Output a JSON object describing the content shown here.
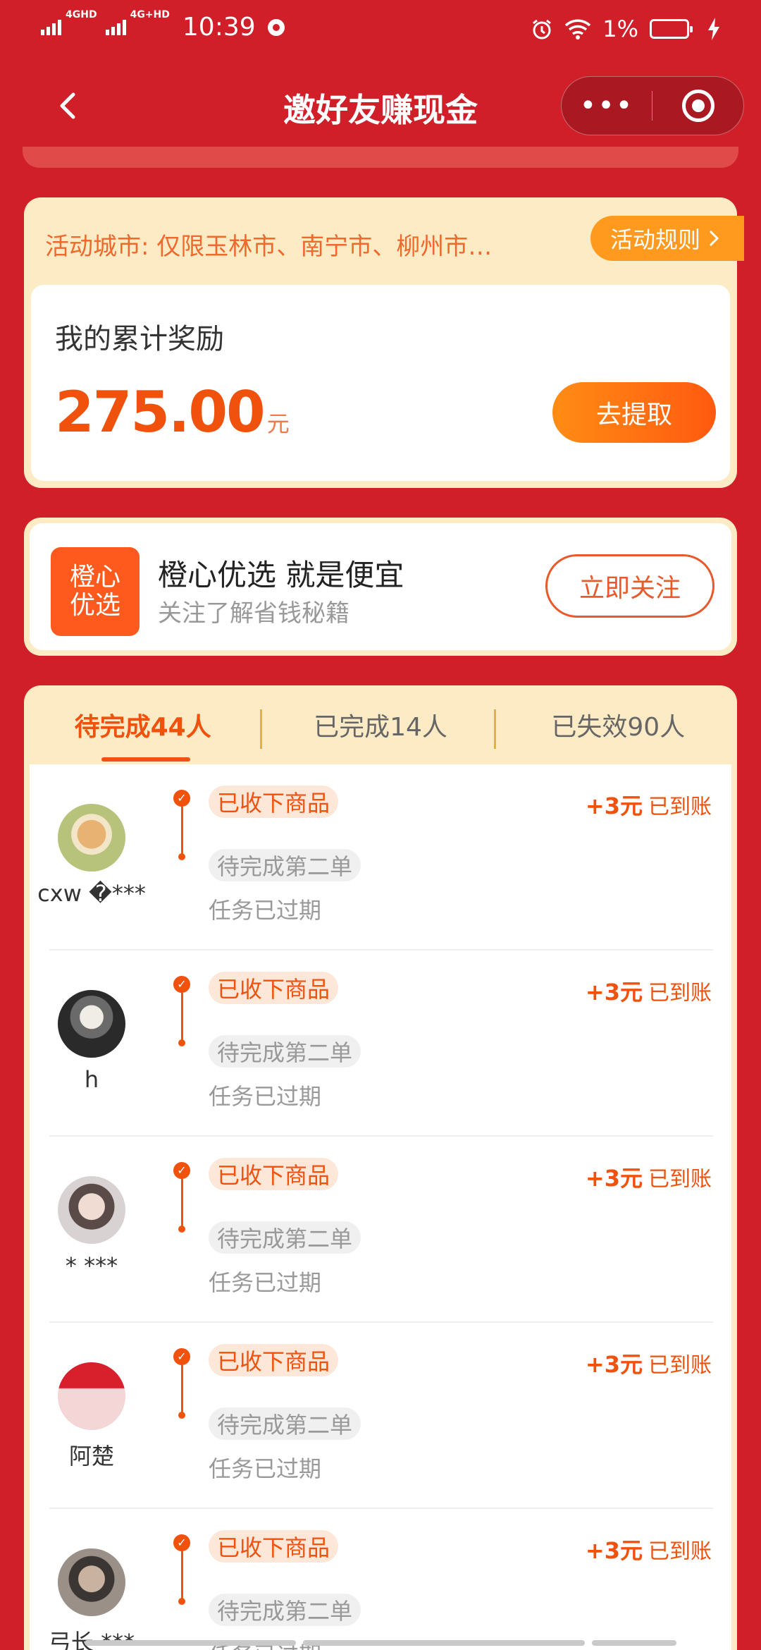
{
  "status_bar": {
    "net1": "4GHD",
    "net2": "4G+HD",
    "time": "10:39",
    "battery": "1%"
  },
  "header": {
    "title": "邀好友赚现金",
    "more": "•••"
  },
  "reward_card": {
    "notice": "活动城市: 仅限玉林市、南宁市、柳州市…",
    "rules": "活动规则",
    "label": "我的累计奖励",
    "amount": "275.00",
    "unit": "元",
    "withdraw": "去提取"
  },
  "follow_card": {
    "logo": "橙心优选",
    "logo_line1": "橙心",
    "logo_line2": "优选",
    "title": "橙心优选 就是便宜",
    "subtitle": "关注了解省钱秘籍",
    "button": "立即关注"
  },
  "tabs": [
    {
      "label": "待完成44人",
      "active": true
    },
    {
      "label": "已完成14人",
      "active": false
    },
    {
      "label": "已失效90人",
      "active": false
    }
  ],
  "rows": [
    {
      "name": "cxw �***",
      "step1": "已收下商品",
      "step2": "待完成第二单",
      "note": "任务已过期",
      "amount": "+3元",
      "status": "已到账"
    },
    {
      "name": "h",
      "step1": "已收下商品",
      "step2": "待完成第二单",
      "note": "任务已过期",
      "amount": "+3元",
      "status": "已到账"
    },
    {
      "name": "* ***",
      "step1": "已收下商品",
      "step2": "待完成第二单",
      "note": "任务已过期",
      "amount": "+3元",
      "status": "已到账"
    },
    {
      "name": "阿楚",
      "step1": "已收下商品",
      "step2": "待完成第二单",
      "note": "任务已过期",
      "amount": "+3元",
      "status": "已到账"
    },
    {
      "name": "弓长 ***",
      "step1": "已收下商品",
      "step2": "待完成第二单",
      "note": "任务已过期",
      "amount": "+3元",
      "status": "已到账"
    }
  ],
  "colors": {
    "background": "#d01f29",
    "accent": "#f0520e",
    "card": "#fdebc6"
  },
  "icons": [
    "back-arrow-icon",
    "more-dots-icon",
    "close-circle-icon",
    "chevron-right-icon",
    "check-icon",
    "alarm-icon",
    "wifi-icon",
    "battery-icon",
    "charging-icon"
  ]
}
